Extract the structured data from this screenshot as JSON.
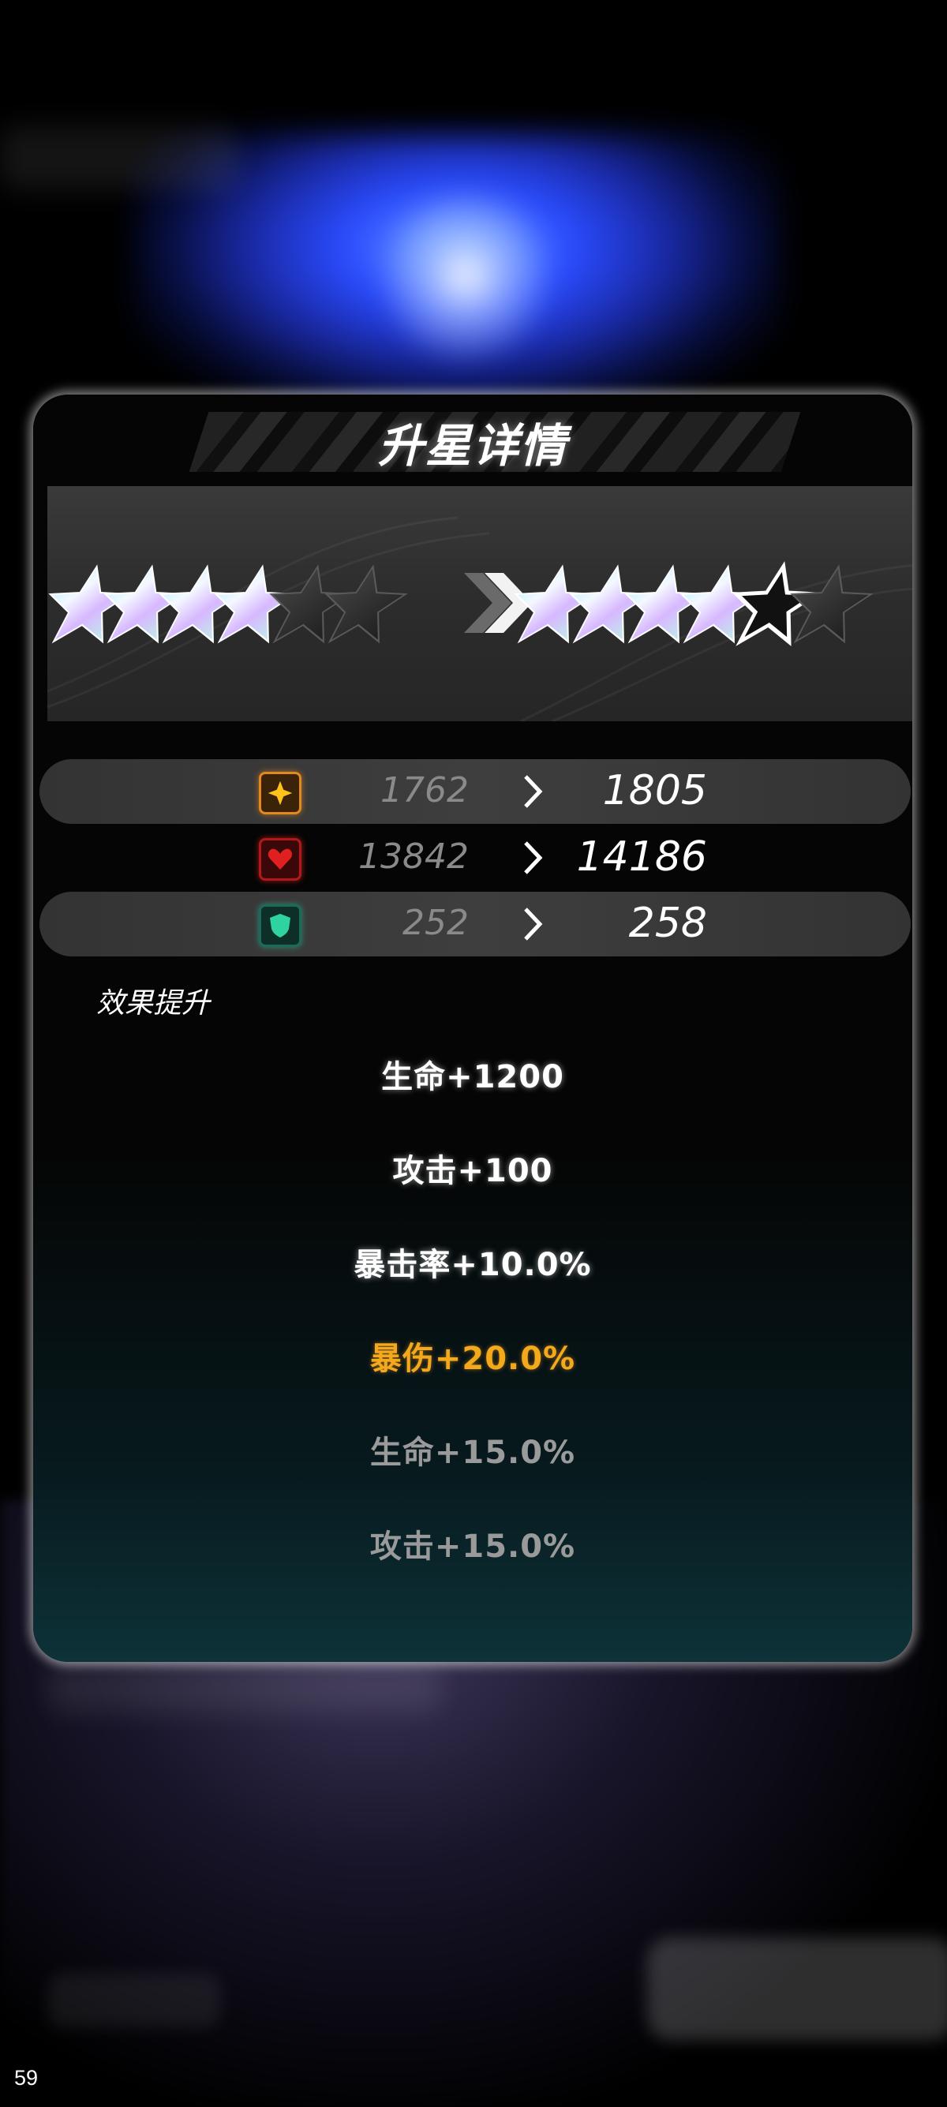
{
  "panel": {
    "title": "升星详情",
    "current_stars": {
      "filled": 4,
      "total": 6
    },
    "next_stars": {
      "filled": 4,
      "total": 6,
      "highlighted": 5
    }
  },
  "stats": [
    {
      "icon": "attack-star-icon",
      "color": "#e08a1e",
      "old": "1762",
      "new": "1805"
    },
    {
      "icon": "heart-icon",
      "color": "#e02020",
      "old": "13842",
      "new": "14186"
    },
    {
      "icon": "shield-icon",
      "color": "#2ed3a0",
      "old": "252",
      "new": "258"
    }
  ],
  "effects": {
    "label": "效果提升",
    "items": [
      {
        "text": "生命+1200",
        "style": "white"
      },
      {
        "text": "攻击+100",
        "style": "white"
      },
      {
        "text": "暴击率+10.0%",
        "style": "white"
      },
      {
        "text": "暴伤+20.0%",
        "style": "gold"
      },
      {
        "text": "生命+15.0%",
        "style": "gray"
      },
      {
        "text": "攻击+15.0%",
        "style": "gray"
      }
    ]
  },
  "fps": "59"
}
